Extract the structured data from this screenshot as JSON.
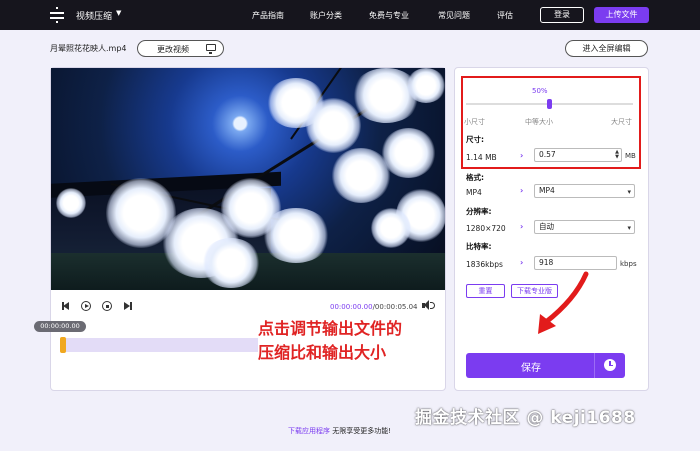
{
  "header": {
    "app_name": "视频压缩",
    "nav": [
      "产品指南",
      "账户分类",
      "免费与专业",
      "常见问题",
      "评估"
    ],
    "login_label": "登录",
    "upload_label": "上传文件"
  },
  "file_bar": {
    "file_name": "月晕照花花映人.mp4",
    "change_video_label": "更改视频",
    "fullscreen_label": "进入全屏编辑"
  },
  "player": {
    "current_time": "00:00:00.00",
    "total_time": "/00:00:05.04",
    "badge_time": "00:00:00.00",
    "progress": 0
  },
  "annotation": {
    "line1": "点击调节输出文件的",
    "line2": "压缩比和输出大小"
  },
  "settings": {
    "compression_percent": "50%",
    "compression_value": 0.5,
    "slider_marks": [
      "小尺寸",
      "中等大小",
      "大尺寸"
    ],
    "size": {
      "label": "尺寸:",
      "original": "1.14 MB",
      "output": "0.57",
      "unit": "MB"
    },
    "format": {
      "label": "格式:",
      "original": "MP4",
      "output": "MP4"
    },
    "resolution": {
      "label": "分辨率:",
      "original": "1280×720",
      "output": "自动"
    },
    "bitrate": {
      "label": "比特率:",
      "original": "1836kbps",
      "output": "918",
      "unit": "kbps"
    },
    "reset_label": "重置",
    "pro_label": "下载专业版",
    "save_label": "保存"
  },
  "footer": {
    "link_text": "下载应用程序",
    "rest_text": " 无限享受更多功能!"
  },
  "watermark": "掘金技术社区 @ keji1688",
  "colors": {
    "accent": "#7b3cf0",
    "nav_bg": "#16151d",
    "highlight_red": "#e21b1b",
    "handle": "#f0a820"
  },
  "icons": [
    "menu-logo-icon",
    "monitor-icon",
    "prev-frame-icon",
    "play-icon",
    "stop-icon",
    "next-frame-icon",
    "volume-icon",
    "clock-icon",
    "chevron-right-icon",
    "caret-down-icon"
  ]
}
